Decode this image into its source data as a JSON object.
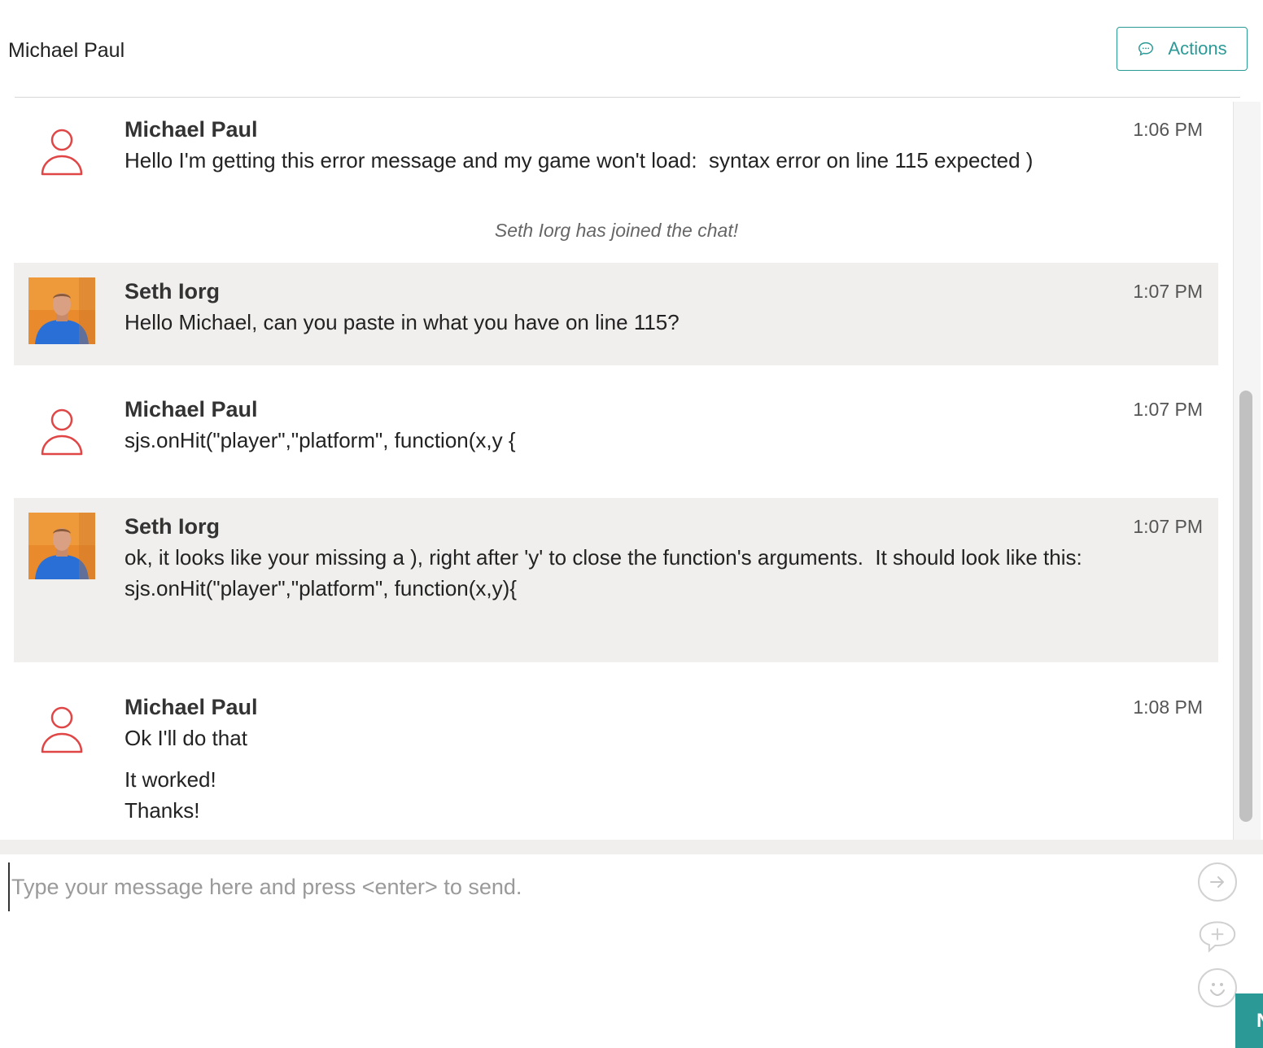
{
  "header": {
    "title": "Michael Paul",
    "actions_label": "Actions"
  },
  "system_message": "Seth Iorg has joined the chat!",
  "messages": [
    {
      "sender": "Michael Paul",
      "time": "1:06 PM",
      "text": "Hello I'm getting this error message and my game won't load:  syntax error on line 115 expected )",
      "role": "visitor"
    },
    {
      "sender": "Seth Iorg",
      "time": "1:07 PM",
      "text": "Hello Michael, can you paste in what you have on line 115?",
      "role": "agent"
    },
    {
      "sender": "Michael Paul",
      "time": "1:07 PM",
      "text": "sjs.onHit(\"player\",\"platform\", function(x,y {",
      "role": "visitor"
    },
    {
      "sender": "Seth Iorg",
      "time": "1:07 PM",
      "text": "ok, it looks like your missing a ), right after 'y' to close the function's arguments.  It should look like this:\nsjs.onHit(\"player\",\"platform\", function(x,y){",
      "role": "agent"
    },
    {
      "sender": "Michael Paul",
      "time": "1:08 PM",
      "text": "Ok I'll do that",
      "text2": "It worked!\nThanks!",
      "role": "visitor"
    }
  ],
  "composer": {
    "placeholder": "Type your message here and press <enter> to send.",
    "corner_label": "N"
  },
  "colors": {
    "accent": "#2b9a97",
    "visitor_icon": "#e04646",
    "agent_bg": "#f0efed"
  },
  "icons": [
    "chat-bubble-icon",
    "user-outline-icon",
    "send-arrow-icon",
    "add-attachment-icon",
    "emoji-icon"
  ]
}
